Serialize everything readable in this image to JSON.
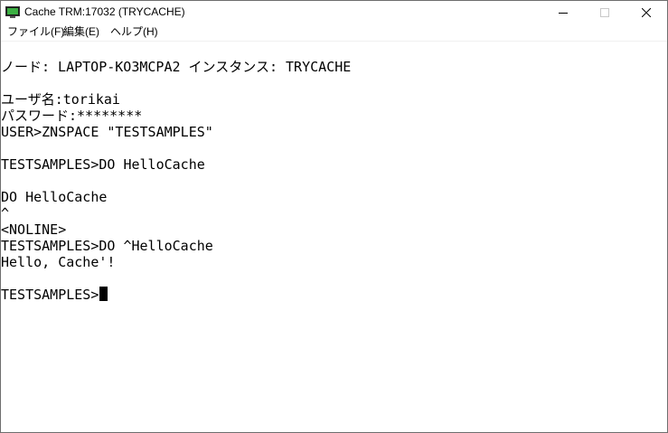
{
  "window": {
    "title": "Cache TRM:17032 (TRYCACHE)"
  },
  "titlebar_icons": {
    "app": "terminal-app-icon",
    "minimize": "minimize-icon",
    "maximize": "maximize-icon",
    "close": "close-icon"
  },
  "menu": {
    "items": [
      {
        "label": "ファイル(F)"
      },
      {
        "label": "編集(E)"
      },
      {
        "label": "ヘルプ(H)"
      }
    ]
  },
  "terminal": {
    "lines": [
      "ノード: LAPTOP-KO3MCPA2 インスタンス: TRYCACHE",
      "",
      "ユーザ名:torikai",
      "パスワード:********",
      "USER>ZNSPACE \"TESTSAMPLES\"",
      "",
      "TESTSAMPLES>DO HelloCache",
      "",
      "DO HelloCache",
      "^",
      "<NOLINE>",
      "TESTSAMPLES>DO ^HelloCache",
      "Hello, Cache'!",
      "",
      "TESTSAMPLES>"
    ]
  },
  "colors": {
    "background": "#ffffff",
    "text": "#000000",
    "cursor": "#000000"
  }
}
